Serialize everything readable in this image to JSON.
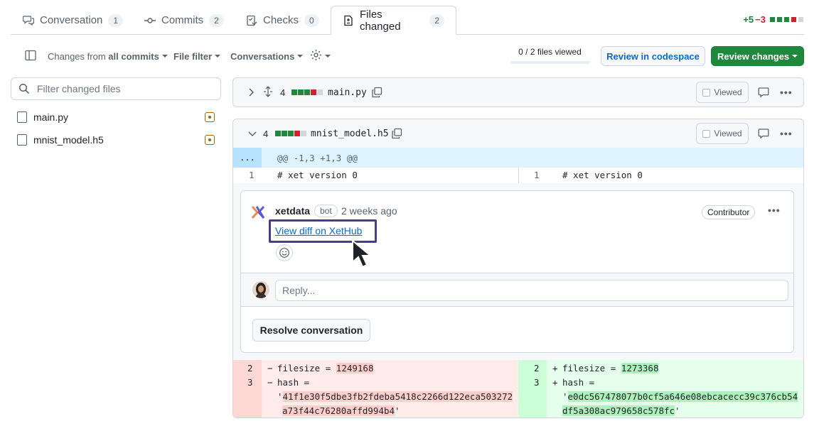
{
  "tabs": [
    {
      "label": "Conversation",
      "count": "1",
      "icon": "comment-discussion-icon"
    },
    {
      "label": "Commits",
      "count": "2",
      "icon": "git-commit-icon"
    },
    {
      "label": "Checks",
      "count": "0",
      "icon": "checklist-icon"
    },
    {
      "label": "Files changed",
      "count": "2",
      "icon": "file-diff-icon",
      "active": true
    }
  ],
  "diffstat": {
    "additions": "+5",
    "deletions": "−3",
    "blocks": [
      "g",
      "g",
      "g",
      "r",
      "n"
    ]
  },
  "toolbar": {
    "changes_prefix": "Changes from",
    "changes_value": "all commits",
    "file_filter": "File filter",
    "conversations": "Conversations",
    "files_viewed": "0 / 2 files viewed",
    "review_codespace": "Review in codespace",
    "review_changes": "Review changes"
  },
  "sidebar": {
    "search_placeholder": "Filter changed files",
    "files": [
      {
        "name": "main.py"
      },
      {
        "name": "mnist_model.h5"
      }
    ]
  },
  "files": [
    {
      "count": "4",
      "name": "main.py",
      "blocks": [
        "g",
        "g",
        "g",
        "r",
        "n"
      ],
      "viewed_label": "Viewed",
      "expanded": false
    },
    {
      "count": "4",
      "name": "mnist_model.h5",
      "blocks": [
        "g",
        "g",
        "g",
        "r",
        "n"
      ],
      "viewed_label": "Viewed",
      "expanded": true
    }
  ],
  "diff": {
    "hunk_marker": "...",
    "hunk_header": "@@ -1,3 +1,3 @@",
    "context_line": {
      "left_num": "1",
      "right_num": "1",
      "text": "# xet version 0"
    },
    "deleted": {
      "nums": [
        "2",
        "3"
      ],
      "sign": "−",
      "line1_prefix": "filesize = ",
      "line1_value": "1249168",
      "line2": "hash =",
      "line3_value": "41f1e30f5dbe3fb2fdeba5418c2266d122eca503272",
      "line4_value": "a73f44c76280affd994b4"
    },
    "added": {
      "nums": [
        "2",
        "3"
      ],
      "sign": "+",
      "line1_prefix": "filesize = ",
      "line1_value": "1273368",
      "line2": "hash =",
      "line3_value": "e0dc567478077b0cf5a646e08ebcacecc39c376cb54",
      "line4_value": "df5a308ac979658c578fc"
    }
  },
  "comment": {
    "author": "xetdata",
    "bot_badge": "bot",
    "time": "2 weeks ago",
    "role_badge": "Contributor",
    "link_text": "View diff on XetHub",
    "reply_placeholder": "Reply...",
    "resolve_label": "Resolve conversation"
  },
  "colors": {
    "accent_green": "#1f883d",
    "deleted_bg": "#ffebe9",
    "added_bg": "#e6ffec",
    "highlight_box": "#4a3b8f",
    "link": "#0969da"
  }
}
